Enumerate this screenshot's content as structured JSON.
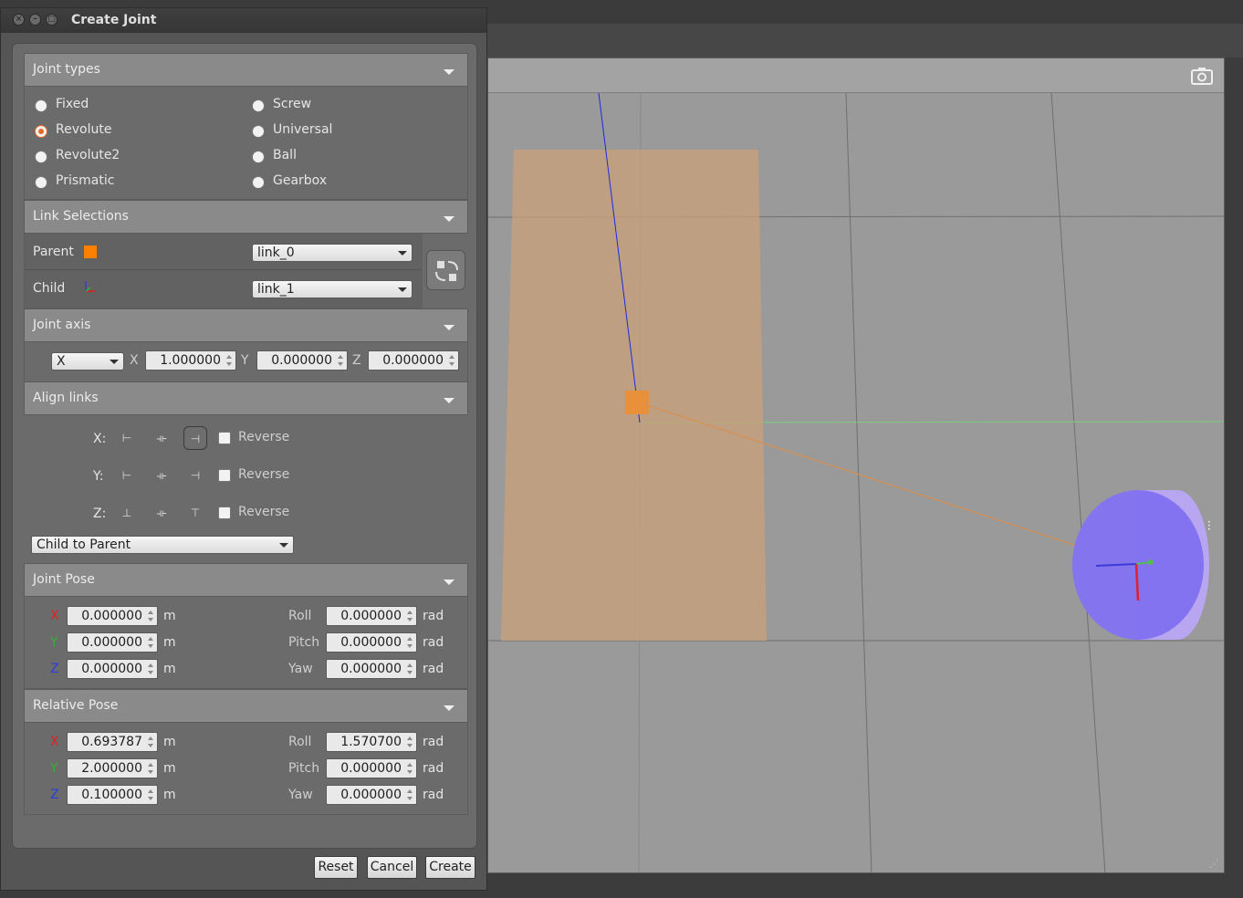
{
  "window": {
    "title": "Create Joint"
  },
  "colors": {
    "accent": "#e36a2c",
    "parent_swatch": "#ff7f00",
    "axis_x": "#e02020",
    "axis_y": "#35b035",
    "axis_z": "#2a3ee0"
  },
  "joint_types": {
    "header": "Joint types",
    "options": [
      "Fixed",
      "Revolute",
      "Revolute2",
      "Prismatic",
      "Screw",
      "Universal",
      "Ball",
      "Gearbox"
    ],
    "selected": "Revolute"
  },
  "link_selections": {
    "header": "Link Selections",
    "parent_label": "Parent",
    "parent_value": "link_0",
    "child_label": "Child",
    "child_value": "link_1",
    "swap_icon": "swap-icon"
  },
  "joint_axis": {
    "header": "Joint axis",
    "axis_select": "X",
    "x_label": "X",
    "x_value": "1.000000",
    "y_label": "Y",
    "y_value": "0.000000",
    "z_label": "Z",
    "z_value": "0.000000"
  },
  "align_links": {
    "header": "Align links",
    "rows": [
      {
        "label": "X:",
        "reverse": "Reverse"
      },
      {
        "label": "Y:",
        "reverse": "Reverse"
      },
      {
        "label": "Z:",
        "reverse": "Reverse"
      }
    ],
    "mode": "Child to Parent"
  },
  "joint_pose": {
    "header": "Joint Pose",
    "x": "0.000000",
    "y": "0.000000",
    "z": "0.000000",
    "roll": "0.000000",
    "pitch": "0.000000",
    "yaw": "0.000000"
  },
  "relative_pose": {
    "header": "Relative Pose",
    "x": "0.693787",
    "y": "2.000000",
    "z": "0.100000",
    "roll": "1.570700",
    "pitch": "0.000000",
    "yaw": "0.000000"
  },
  "labels": {
    "x": "X",
    "y": "Y",
    "z": "Z",
    "roll": "Roll",
    "pitch": "Pitch",
    "yaw": "Yaw",
    "unit_m": "m",
    "unit_rad": "rad"
  },
  "buttons": {
    "reset": "Reset",
    "cancel": "Cancel",
    "create": "Create"
  }
}
